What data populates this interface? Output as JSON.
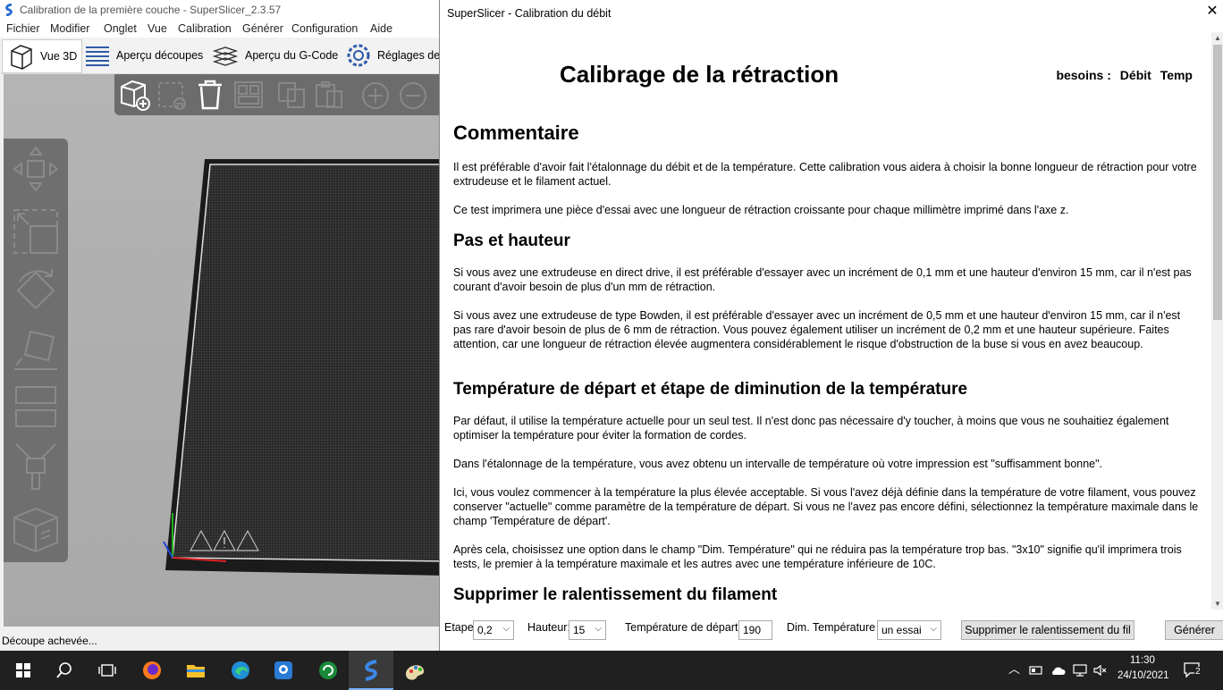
{
  "main_window": {
    "title": "Calibration de la première couche - SuperSlicer_2.3.57",
    "menu": [
      "Fichier",
      "Modifier",
      "Onglet",
      "Vue",
      "Calibration",
      "Générer",
      "Configuration",
      "Aide"
    ],
    "tabs": [
      "Vue 3D",
      "Aperçu découpes",
      "Aperçu du G-Code",
      "Réglages de"
    ],
    "status": "Découpe achevée..."
  },
  "dialog": {
    "title": "SuperSlicer - Calibration du débit",
    "heading": "Calibrage de la rétraction",
    "needs_label": "besoins :",
    "needs_items": [
      "Débit",
      "Temp"
    ],
    "sections": {
      "commentaire": {
        "title": "Commentaire",
        "p1": "Il est préférable d'avoir fait l'étalonnage du débit et de la température. Cette calibration vous aidera à choisir la bonne longueur de rétraction pour votre extrudeuse et le filament actuel.",
        "p2": "Ce test imprimera une pièce d'essai avec une longueur de rétraction croissante pour chaque millimètre imprimé dans l'axe z."
      },
      "pas": {
        "title": "Pas et hauteur",
        "p1": "Si vous avez une extrudeuse en direct drive, il est préférable d'essayer avec un incrément de 0,1 mm et une hauteur d'environ 15 mm, car il n'est pas courant d'avoir besoin de plus d'un mm de rétraction.",
        "p2": "Si vous avez une extrudeuse de type Bowden, il est préférable d'essayer avec un incrément de 0,5 mm et une hauteur d'environ 15 mm, car il n'est pas rare d'avoir besoin de plus de 6 mm de rétraction. Vous pouvez également utiliser un incrément de 0,2 mm et une hauteur supérieure. Faites attention, car une longueur de rétraction élevée augmentera considérablement le risque d'obstruction de la buse si vous en avez beaucoup."
      },
      "temp": {
        "title": "Température de départ et étape de diminution de la température",
        "p1": "Par défaut, il utilise la température actuelle pour un seul test. Il n'est donc pas nécessaire d'y toucher, à moins que vous ne souhaitiez également optimiser la température pour éviter la formation de cordes.",
        "p2": "Dans l'étalonnage de la température, vous avez obtenu un intervalle de température où votre impression est \"suffisamment bonne\".",
        "p3": "Ici, vous voulez commencer à la température la plus élevée acceptable. Si vous l'avez déjà définie dans la température de votre filament, vous pouvez conserver \"actuelle\" comme paramètre de la température de départ. Si vous ne l'avez pas encore défini, sélectionnez la température maximale dans le champ 'Température de départ'.",
        "p4": "Après cela, choisissez une option dans le champ \"Dim. Température\" qui ne réduira pas la température trop bas. \"3x10\" signifie qu'il imprimera trois tests, le premier à la température maximale et les autres avec une température inférieure de 10C."
      },
      "ralentissement": {
        "title": "Supprimer le ralentissement du filament"
      }
    },
    "controls": {
      "etape_label": "Etape:",
      "etape_value": "0,2",
      "hauteur_label": "Hauteur:",
      "hauteur_value": "15",
      "temp_depart_label": "Température de départ :",
      "temp_depart_value": "190",
      "dim_temp_label": "Dim. Température :",
      "dim_temp_value": "un essai",
      "remove_slowdown_button": "Supprimer le ralentissement du fil",
      "generate_button": "Générer"
    }
  },
  "taskbar": {
    "time": "11:30",
    "date": "24/10/2021",
    "notifications": "2"
  }
}
